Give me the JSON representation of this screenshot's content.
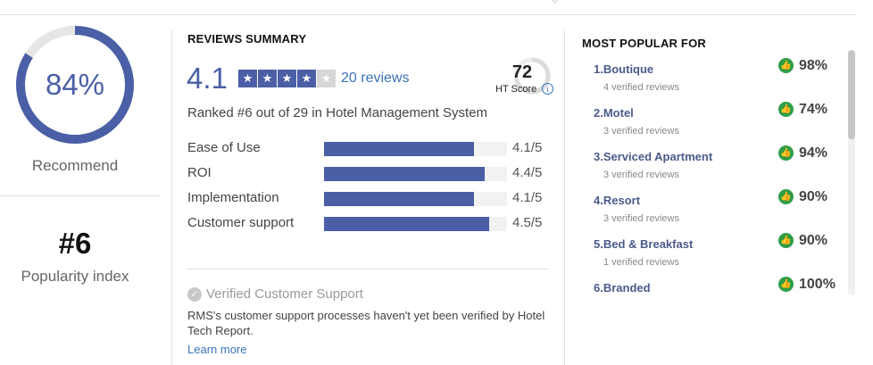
{
  "recommend": {
    "percent_text": "84%",
    "percent": 84,
    "label": "Recommend"
  },
  "popularity": {
    "rank": "#6",
    "label": "Popularity index"
  },
  "summary": {
    "title": "REVIEWS SUMMARY",
    "score": "4.1",
    "stars_filled": 4,
    "stars_total": 5,
    "review_count": "20 reviews",
    "ht_score": "72",
    "ht_score_fraction": 0.72,
    "ht_label": "HT Score",
    "ranked_text": "Ranked #6 out of 29 in Hotel Management System",
    "ratings": [
      {
        "label": "Ease of Use",
        "value": "4.1/5",
        "fraction": 0.82
      },
      {
        "label": "ROI",
        "value": "4.4/5",
        "fraction": 0.88
      },
      {
        "label": "Implementation",
        "value": "4.1/5",
        "fraction": 0.82
      },
      {
        "label": "Customer support",
        "value": "4.5/5",
        "fraction": 0.9
      }
    ],
    "verified_title": "Verified Customer Support",
    "verified_desc": "RMS's customer support processes haven't yet been verified by Hotel Tech Report.",
    "learn_more": "Learn more"
  },
  "popular": {
    "title": "MOST POPULAR FOR",
    "items": [
      {
        "name": "1.Boutique",
        "sub": "4 verified reviews",
        "pct": "98%"
      },
      {
        "name": "2.Motel",
        "sub": "3 verified reviews",
        "pct": "74%"
      },
      {
        "name": "3.Serviced Apartment",
        "sub": "3 verified reviews",
        "pct": "94%"
      },
      {
        "name": "4.Resort",
        "sub": "3 verified reviews",
        "pct": "90%"
      },
      {
        "name": "5.Bed & Breakfast",
        "sub": "1 verified reviews",
        "pct": "90%"
      },
      {
        "name": "6.Branded",
        "sub": "",
        "pct": "100%"
      }
    ]
  },
  "colors": {
    "accent": "#4a5fa5",
    "link": "#3a73b8",
    "thumb": "#2f9e47",
    "track": "#f2f2f2"
  },
  "icons": {
    "star": "star-icon",
    "thumb": "thumbs-up-icon",
    "check": "check-circle-icon",
    "info": "info-icon"
  }
}
